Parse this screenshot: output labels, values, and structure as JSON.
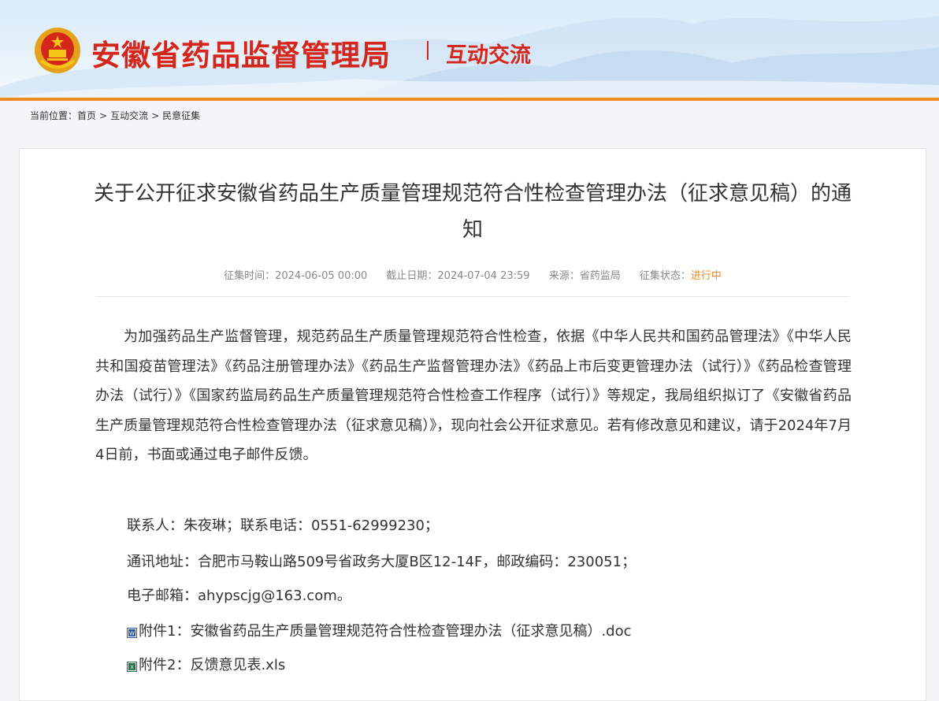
{
  "header": {
    "site_title": "安徽省药品监督管理局",
    "section_title": "互动交流",
    "accent_color": "#d5261c",
    "bar_color": "#f08a24"
  },
  "breadcrumb": {
    "prefix": "当前位置：",
    "items": [
      "首页",
      "互动交流",
      "民意征集"
    ],
    "separator": ">"
  },
  "article": {
    "title": "关于公开征求安徽省药品生产质量管理规范符合性检查管理办法（征求意见稿）的通知",
    "meta": {
      "collect_time": "征集时间：2024-06-05 00:00",
      "deadline": "截止日期：2024-07-04 23:59",
      "source": "来源：省药监局",
      "status_label": "征集状态：",
      "status_value": "进行中"
    },
    "body": "为加强药品生产监督管理，规范药品生产质量管理规范符合性检查，依据《中华人民共和国药品管理法》《中华人民共和国疫苗管理法》《药品注册管理办法》《药品生产监督管理办法》《药品上市后变更管理办法（试行）》《药品检查管理办法（试行）》《国家药监局药品生产质量管理规范符合性检查工作程序（试行）》等规定，我局组织拟订了《安徽省药品生产质量管理规范符合性检查管理办法（征求意见稿）》，现向社会公开征求意见。若有修改意见和建议，请于2024年7月4日前，书面或通过电子邮件反馈。",
    "contact": "联系人：朱夜琳；联系电话：0551-62999230；",
    "address": "通讯地址：合肥市马鞍山路509号省政务大厦B区12-14F，邮政编码：230051；",
    "email": "电子邮箱：ahypscjg@163.com。",
    "attachments": [
      {
        "label": "附件1：安徽省药品生产质量管理规范符合性检查管理办法（征求意见稿）.doc",
        "icon": "word-file-icon"
      },
      {
        "label": "附件2：反馈意见表.xls",
        "icon": "excel-file-icon"
      }
    ]
  }
}
